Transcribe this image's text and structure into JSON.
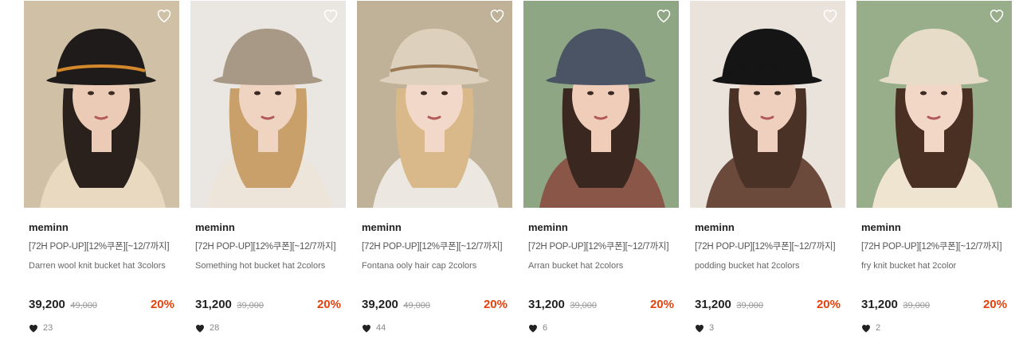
{
  "products": [
    {
      "brand": "meminn",
      "promo": "[72H POP-UP][12%쿠폰][~12/7까지]",
      "name": "Darren wool knit bucket hat 3colors",
      "price": "39,200",
      "original_price": "49,000",
      "discount": "20%",
      "likes": "23",
      "photo": {
        "bg": "#c9b89a",
        "hat": "#1e1b1a",
        "hat_accent": "#d4882c",
        "hair": "#2a201c",
        "skin": "#eccbb6",
        "top": "#e8d9c0"
      }
    },
    {
      "brand": "meminn",
      "promo": "[72H POP-UP][12%쿠폰][~12/7까지]",
      "name": "Something hot bucket hat 2colors",
      "price": "31,200",
      "original_price": "39,000",
      "discount": "20%",
      "likes": "28",
      "photo": {
        "bg": "#e8e4df",
        "hat": "#a89886",
        "hat_accent": "#a89886",
        "hair": "#c9a06a",
        "skin": "#f0d4c2",
        "top": "#ede4da"
      }
    },
    {
      "brand": "meminn",
      "promo": "[72H POP-UP][12%쿠폰][~12/7까지]",
      "name": "Fontana ooly hair cap 2colors",
      "price": "39,200",
      "original_price": "49,000",
      "discount": "20%",
      "likes": "44",
      "photo": {
        "bg": "#b8a88a",
        "hat": "#ddd0bc",
        "hat_accent": "#9b7a55",
        "hair": "#d9b98a",
        "skin": "#f2d8c8",
        "top": "#ece8e1"
      }
    },
    {
      "brand": "meminn",
      "promo": "[72H POP-UP][12%쿠폰][~12/7까지]",
      "name": "Arran bucket hat 2colors",
      "price": "31,200",
      "original_price": "39,000",
      "discount": "20%",
      "likes": "6",
      "photo": {
        "bg": "#7f9a72",
        "hat": "#4a5464",
        "hat_accent": "#4a5464",
        "hair": "#3a2820",
        "skin": "#efcdb9",
        "top": "#8a5648"
      }
    },
    {
      "brand": "meminn",
      "promo": "[72H POP-UP][12%쿠폰][~12/7까지]",
      "name": "podding bucket hat 2colors",
      "price": "31,200",
      "original_price": "39,000",
      "discount": "20%",
      "likes": "3",
      "photo": {
        "bg": "#e6e0d8",
        "hat": "#151515",
        "hat_accent": "#151515",
        "hair": "#4a3226",
        "skin": "#efd0be",
        "top": "#6b4a3c"
      }
    },
    {
      "brand": "meminn",
      "promo": "[72H POP-UP][12%쿠폰][~12/7까지]",
      "name": "fry knit bucket hat 2color",
      "price": "31,200",
      "original_price": "39,000",
      "discount": "20%",
      "likes": "2",
      "photo": {
        "bg": "#8aa37a",
        "hat": "#e6dcc8",
        "hat_accent": "#e6dcc8",
        "hair": "#4a3022",
        "skin": "#f2d6c6",
        "top": "#efe4d0"
      }
    }
  ],
  "icons": {
    "wishlist": "heart-outline-icon",
    "likes": "heart-filled-icon"
  },
  "colors": {
    "discount": "#e5410c",
    "text": "#222222",
    "muted": "#999999"
  }
}
